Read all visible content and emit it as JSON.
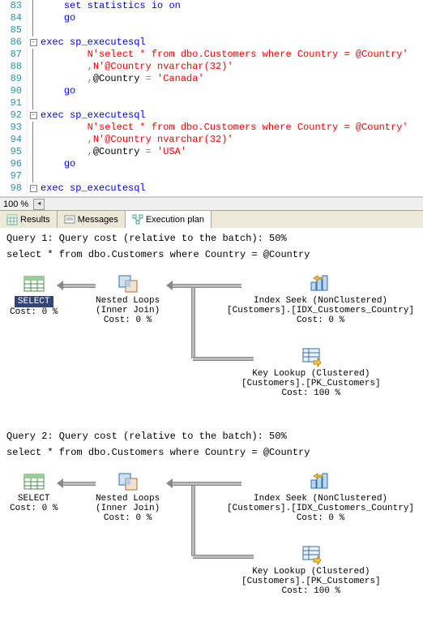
{
  "editor": {
    "lines": [
      {
        "num": 83,
        "outline": "bar",
        "indent": 1,
        "tokens": [
          [
            "kw",
            "set"
          ],
          [
            "plain",
            " "
          ],
          [
            "kw",
            "statistics"
          ],
          [
            "plain",
            " "
          ],
          [
            "kw",
            "io"
          ],
          [
            "plain",
            " "
          ],
          [
            "kw",
            "on"
          ]
        ]
      },
      {
        "num": 84,
        "outline": "bar",
        "indent": 1,
        "tokens": [
          [
            "kw",
            "go"
          ]
        ]
      },
      {
        "num": 85,
        "outline": "bar",
        "indent": 0,
        "tokens": []
      },
      {
        "num": 86,
        "outline": "box",
        "indent": 0,
        "tokens": [
          [
            "kw",
            "exec"
          ],
          [
            "plain",
            " "
          ],
          [
            "kw",
            "sp_executesql"
          ]
        ]
      },
      {
        "num": 87,
        "outline": "bar2",
        "indent": 2,
        "tokens": [
          [
            "str",
            "N'select * from dbo.Customers where Country = @Country'"
          ]
        ]
      },
      {
        "num": 88,
        "outline": "bar2",
        "indent": 2,
        "tokens": [
          [
            "op",
            ","
          ],
          [
            "str",
            "N'@Country nvarchar(32)'"
          ]
        ]
      },
      {
        "num": 89,
        "outline": "bar2",
        "indent": 2,
        "tokens": [
          [
            "op",
            ","
          ],
          [
            "plain",
            "@Country "
          ],
          [
            "op",
            "="
          ],
          [
            "plain",
            " "
          ],
          [
            "str",
            "'Canada'"
          ]
        ]
      },
      {
        "num": 90,
        "outline": "bar",
        "indent": 1,
        "tokens": [
          [
            "kw",
            "go"
          ]
        ]
      },
      {
        "num": 91,
        "outline": "bar",
        "indent": 0,
        "tokens": []
      },
      {
        "num": 92,
        "outline": "box",
        "indent": 0,
        "tokens": [
          [
            "kw",
            "exec"
          ],
          [
            "plain",
            " "
          ],
          [
            "kw",
            "sp_executesql"
          ]
        ]
      },
      {
        "num": 93,
        "outline": "bar2",
        "indent": 2,
        "tokens": [
          [
            "str",
            "N'select * from dbo.Customers where Country = @Country'"
          ]
        ]
      },
      {
        "num": 94,
        "outline": "bar2",
        "indent": 2,
        "tokens": [
          [
            "op",
            ","
          ],
          [
            "str",
            "N'@Country nvarchar(32)'"
          ]
        ]
      },
      {
        "num": 95,
        "outline": "bar2",
        "indent": 2,
        "tokens": [
          [
            "op",
            ","
          ],
          [
            "plain",
            "@Country "
          ],
          [
            "op",
            "="
          ],
          [
            "plain",
            " "
          ],
          [
            "str",
            "'USA'"
          ]
        ]
      },
      {
        "num": 96,
        "outline": "bar",
        "indent": 1,
        "tokens": [
          [
            "kw",
            "go"
          ]
        ]
      },
      {
        "num": 97,
        "outline": "bar",
        "indent": 0,
        "tokens": []
      },
      {
        "num": 98,
        "outline": "box",
        "indent": 0,
        "tokens": [
          [
            "kw",
            "exec"
          ],
          [
            "plain",
            " "
          ],
          [
            "kw",
            "sp_executesql"
          ]
        ]
      }
    ]
  },
  "zoom": "100 %",
  "scroll_left_glyph": "◂",
  "tabs": {
    "results": "Results",
    "messages": "Messages",
    "execution_plan": "Execution plan"
  },
  "plans": [
    {
      "header1": "Query 1: Query cost (relative to the batch): 50%",
      "header2": "select * from dbo.Customers where Country = @Country",
      "select_selected": true,
      "nodes": {
        "select": {
          "title": "SELECT",
          "cost": "Cost: 0 %"
        },
        "nested": {
          "title": "Nested Loops",
          "sub": "(Inner Join)",
          "cost": "Cost: 0 %"
        },
        "seek": {
          "title": "Index Seek (NonClustered)",
          "sub": "[Customers].[IDX_Customers_Country]",
          "cost": "Cost: 0 %"
        },
        "lookup": {
          "title": "Key Lookup (Clustered)",
          "sub": "[Customers].[PK_Customers]",
          "cost": "Cost: 100 %"
        }
      }
    },
    {
      "header1": "Query 2: Query cost (relative to the batch): 50%",
      "header2": "select * from dbo.Customers where Country = @Country",
      "select_selected": false,
      "nodes": {
        "select": {
          "title": "SELECT",
          "cost": "Cost: 0 %"
        },
        "nested": {
          "title": "Nested Loops",
          "sub": "(Inner Join)",
          "cost": "Cost: 0 %"
        },
        "seek": {
          "title": "Index Seek (NonClustered)",
          "sub": "[Customers].[IDX_Customers_Country]",
          "cost": "Cost: 0 %"
        },
        "lookup": {
          "title": "Key Lookup (Clustered)",
          "sub": "[Customers].[PK_Customers]",
          "cost": "Cost: 100 %"
        }
      }
    }
  ]
}
